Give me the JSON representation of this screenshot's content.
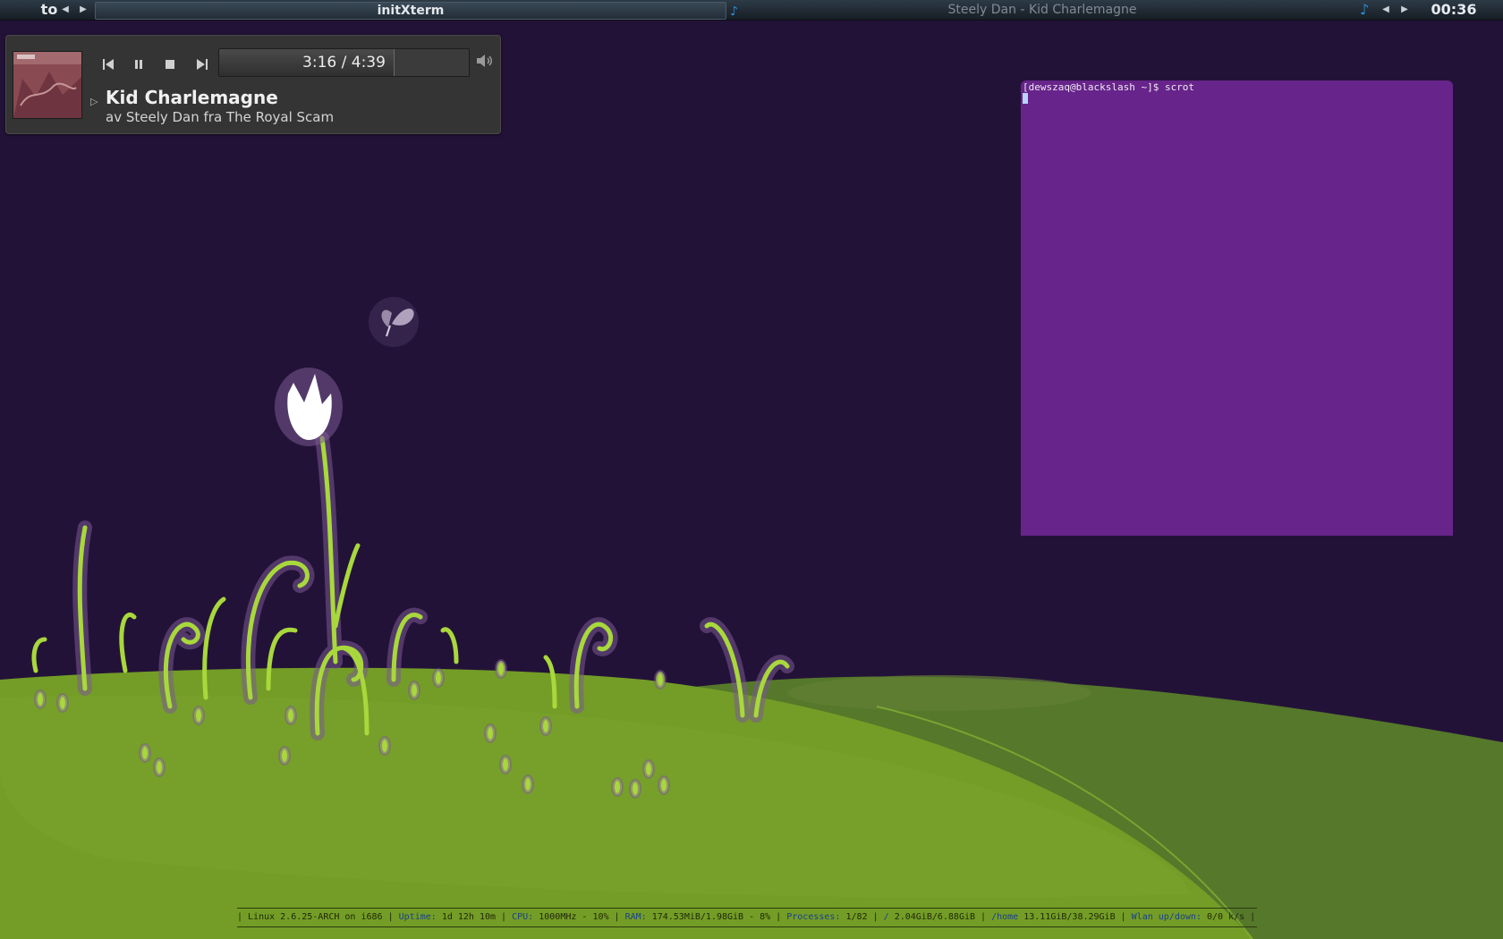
{
  "topbar": {
    "workspace_tag": "to",
    "active_window_title": "initXterm",
    "music_window_title": "Steely Dan - Kid Charlemagne",
    "clock": "00:36"
  },
  "player": {
    "elapsed": "3:16",
    "duration": "4:39",
    "time_display": "3:16 / 4:39",
    "progress": 0.7,
    "title": "Kid Charlemagne",
    "subtitle": "av Steely Dan fra The Royal Scam"
  },
  "terminal": {
    "prompt_line": "[dewszaq@blackslash ~]$ scrot"
  },
  "statusbar": {
    "os": "| Linux 2.6.25-ARCH on i686 |",
    "uptime_label": "Uptime:",
    "uptime_value": "1d 12h 10m |",
    "cpu_label": "CPU:",
    "cpu_value": "1000MHz - 10% |",
    "ram_label": "RAM:",
    "ram_value": "174.53MiB/1.98GiB - 8% |",
    "proc_label": "Processes:",
    "proc_value": "1/82 |",
    "root_label": "/",
    "root_value": "2.04GiB/6.88GiB |",
    "home_label": "/home",
    "home_value": "13.11GiB/38.29GiB |",
    "wlan_label": "Wlan up/down:",
    "wlan_value": "0/0 k/s |"
  },
  "colors": {
    "desktop_bg": "#231238",
    "terminal_bg": "#67248a",
    "hill_green": "#739d26",
    "hill_dark": "#55782a",
    "accent_blue": "#2a8fd8"
  }
}
